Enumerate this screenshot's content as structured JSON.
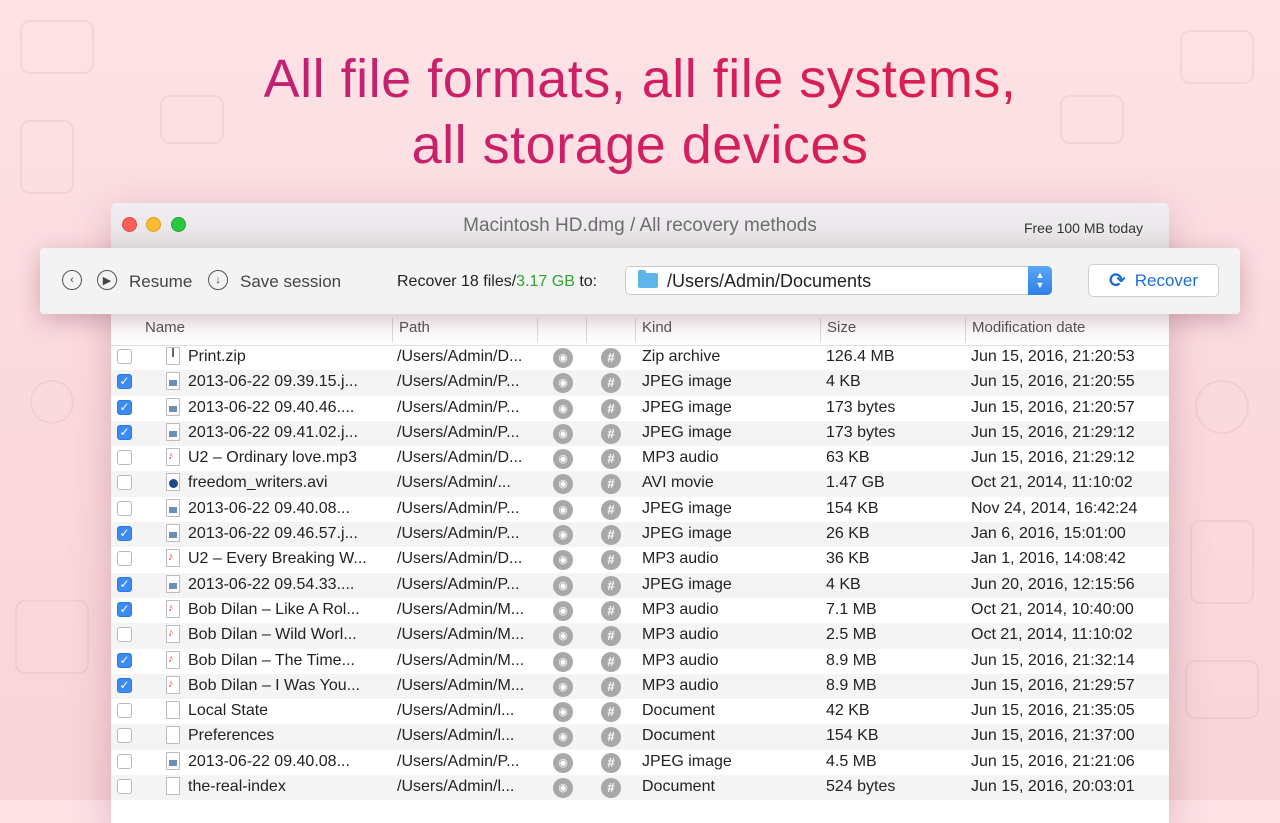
{
  "headline": {
    "line1": "All file formats, all file systems,",
    "line2": "all storage devices"
  },
  "window": {
    "title": "Macintosh HD.dmg / All recovery methods",
    "free_label": "Free 100 MB today"
  },
  "toolbar": {
    "resume_label": "Resume",
    "save_session_label": "Save session",
    "recover_prefix": "Recover 18 files/",
    "recover_size": "3.17 GB",
    "recover_suffix": " to:",
    "path": "/Users/Admin/Documents",
    "recover_button": "Recover",
    "accent_color": "#2fa52f"
  },
  "table": {
    "columns": [
      "Name",
      "Path",
      "",
      "",
      "Kind",
      "Size",
      "Modification date"
    ],
    "rows": [
      {
        "checked": false,
        "icon": "zip",
        "name": "Print.zip",
        "path": "/Users/Admin/D...",
        "kind": "Zip archive",
        "size": "126.4 MB",
        "date": "Jun 15, 2016, 21:20:53"
      },
      {
        "checked": true,
        "icon": "img",
        "name": "2013-06-22 09.39.15.j...",
        "path": "/Users/Admin/P...",
        "kind": "JPEG image",
        "size": "4 KB",
        "date": "Jun 15, 2016, 21:20:55"
      },
      {
        "checked": true,
        "icon": "img",
        "name": "2013-06-22 09.40.46....",
        "path": "/Users/Admin/P...",
        "kind": "JPEG image",
        "size": "173 bytes",
        "date": "Jun 15, 2016, 21:20:57"
      },
      {
        "checked": true,
        "icon": "img",
        "name": "2013-06-22 09.41.02.j...",
        "path": "/Users/Admin/P...",
        "kind": "JPEG image",
        "size": "173 bytes",
        "date": "Jun 15, 2016, 21:29:12"
      },
      {
        "checked": false,
        "icon": "mp3",
        "name": "U2 – Ordinary love.mp3",
        "path": "/Users/Admin/D...",
        "kind": "MP3 audio",
        "size": "63 KB",
        "date": "Jun 15, 2016, 21:29:12"
      },
      {
        "checked": false,
        "icon": "avi",
        "name": "freedom_writers.avi",
        "path": "/Users/Admin/...",
        "kind": "AVI movie",
        "size": "1.47 GB",
        "date": "Oct 21, 2014, 11:10:02"
      },
      {
        "checked": false,
        "icon": "img",
        "name": "2013-06-22 09.40.08...",
        "path": "/Users/Admin/P...",
        "kind": "JPEG image",
        "size": "154 KB",
        "date": "Nov 24, 2014, 16:42:24"
      },
      {
        "checked": true,
        "icon": "img",
        "name": "2013-06-22 09.46.57.j...",
        "path": "/Users/Admin/P...",
        "kind": "JPEG image",
        "size": "26 KB",
        "date": "Jan 6, 2016, 15:01:00"
      },
      {
        "checked": false,
        "icon": "mp3",
        "name": "U2 – Every Breaking W...",
        "path": "/Users/Admin/D...",
        "kind": "MP3 audio",
        "size": "36 KB",
        "date": "Jan 1, 2016, 14:08:42"
      },
      {
        "checked": true,
        "icon": "img",
        "name": "2013-06-22 09.54.33....",
        "path": "/Users/Admin/P...",
        "kind": "JPEG image",
        "size": "4 KB",
        "date": "Jun 20, 2016, 12:15:56"
      },
      {
        "checked": true,
        "icon": "mp3",
        "name": "Bob Dilan – Like A Rol...",
        "path": "/Users/Admin/M...",
        "kind": "MP3 audio",
        "size": "7.1 MB",
        "date": "Oct 21, 2014, 10:40:00"
      },
      {
        "checked": false,
        "icon": "mp3",
        "name": "Bob Dilan – Wild Worl...",
        "path": "/Users/Admin/M...",
        "kind": "MP3 audio",
        "size": "2.5 MB",
        "date": "Oct 21, 2014, 11:10:02"
      },
      {
        "checked": true,
        "icon": "mp3",
        "name": "Bob Dilan – The Time...",
        "path": "/Users/Admin/M...",
        "kind": "MP3 audio",
        "size": "8.9 MB",
        "date": "Jun 15, 2016, 21:32:14"
      },
      {
        "checked": true,
        "icon": "mp3",
        "name": "Bob Dilan – I Was You...",
        "path": "/Users/Admin/M...",
        "kind": "MP3 audio",
        "size": "8.9 MB",
        "date": "Jun 15, 2016, 21:29:57"
      },
      {
        "checked": false,
        "icon": "doc",
        "name": "Local State",
        "path": "/Users/Admin/l...",
        "kind": "Document",
        "size": "42 KB",
        "date": "Jun 15, 2016, 21:35:05"
      },
      {
        "checked": false,
        "icon": "doc",
        "name": "Preferences",
        "path": "/Users/Admin/l...",
        "kind": "Document",
        "size": "154 KB",
        "date": "Jun 15, 2016, 21:37:00"
      },
      {
        "checked": false,
        "icon": "img",
        "name": "2013-06-22 09.40.08...",
        "path": "/Users/Admin/P...",
        "kind": "JPEG image",
        "size": "4.5 MB",
        "date": "Jun 15, 2016, 21:21:06"
      },
      {
        "checked": false,
        "icon": "doc",
        "name": "the-real-index",
        "path": "/Users/Admin/l...",
        "kind": "Document",
        "size": "524 bytes",
        "date": "Jun 15, 2016, 20:03:01"
      }
    ]
  }
}
